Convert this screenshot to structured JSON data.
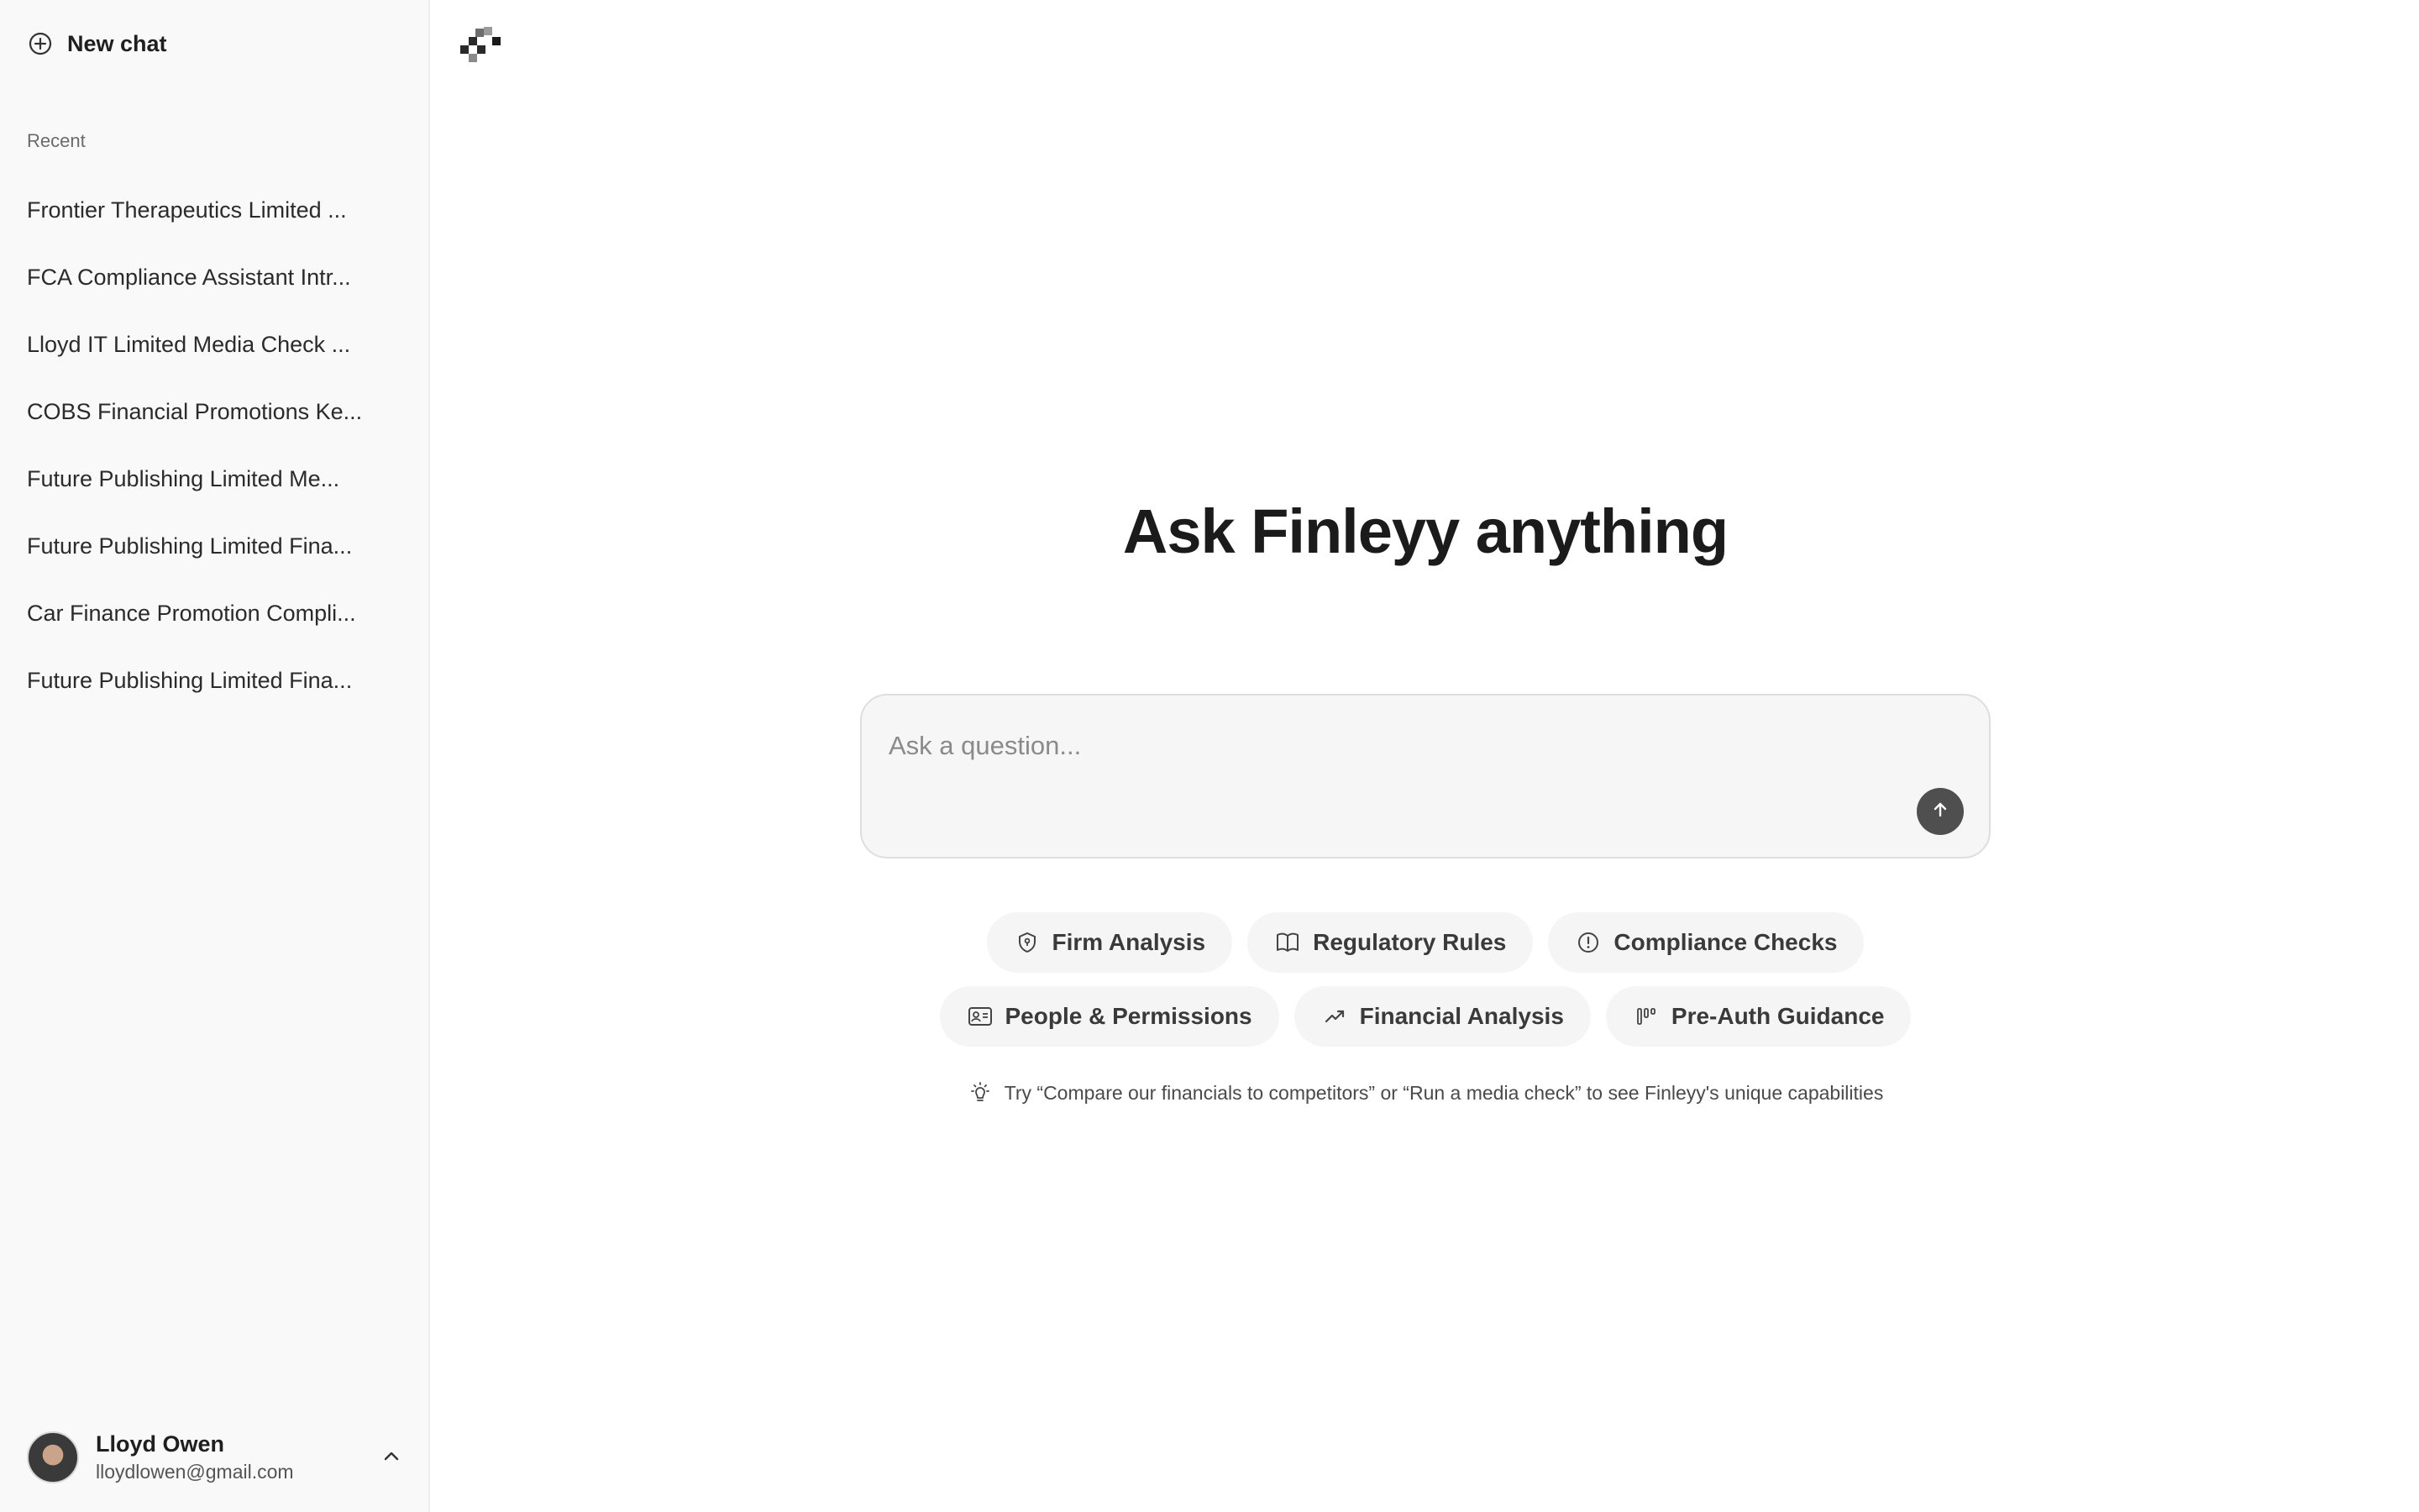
{
  "sidebar": {
    "new_chat_label": "New chat",
    "recent_heading": "Recent",
    "recent_items": [
      "Frontier Therapeutics Limited ...",
      "FCA Compliance Assistant Intr...",
      "Lloyd IT Limited Media Check ...",
      "COBS Financial Promotions Ke...",
      "Future Publishing Limited Me...",
      "Future Publishing Limited Fina...",
      "Car Finance Promotion Compli...",
      "Future Publishing Limited Fina..."
    ],
    "user": {
      "name": "Lloyd Owen",
      "email": "lloydlowen@gmail.com"
    }
  },
  "main": {
    "headline": "Ask Finleyy anything",
    "input_placeholder": "Ask a question...",
    "chips_row1": [
      {
        "label": "Firm Analysis",
        "icon": "shield-icon"
      },
      {
        "label": "Regulatory Rules",
        "icon": "book-icon"
      },
      {
        "label": "Compliance Checks",
        "icon": "alert-circle-icon"
      }
    ],
    "chips_row2": [
      {
        "label": "People & Permissions",
        "icon": "id-card-icon"
      },
      {
        "label": "Financial Analysis",
        "icon": "trend-up-icon"
      },
      {
        "label": "Pre-Auth Guidance",
        "icon": "bars-icon"
      }
    ],
    "tip_text": "Try “Compare our financials to competitors” or “Run a media check” to see Finleyy's unique capabilities"
  },
  "colors": {
    "sidebar_bg": "#f9f9f9",
    "chip_bg": "#f5f5f5",
    "send_button": "#4f4f4f"
  }
}
